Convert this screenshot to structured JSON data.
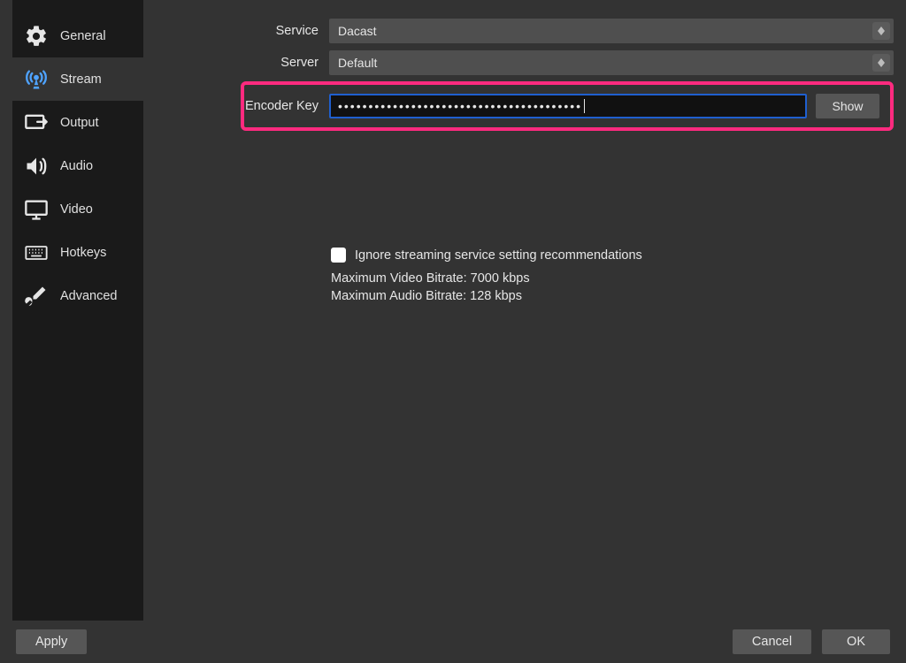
{
  "sidebar": {
    "items": [
      {
        "label": "General"
      },
      {
        "label": "Stream"
      },
      {
        "label": "Output"
      },
      {
        "label": "Audio"
      },
      {
        "label": "Video"
      },
      {
        "label": "Hotkeys"
      },
      {
        "label": "Advanced"
      }
    ],
    "active_index": 1
  },
  "form": {
    "service_label": "Service",
    "service_value": "Dacast",
    "server_label": "Server",
    "server_value": "Default",
    "encoder_label": "Encoder Key",
    "encoder_masked": "••••••••••••••••••••••••••••••••••••••••",
    "show_button": "Show"
  },
  "recommendations": {
    "ignore_label": "Ignore streaming service setting recommendations",
    "ignore_checked": false,
    "max_video": "Maximum Video Bitrate: 7000 kbps",
    "max_audio": "Maximum Audio Bitrate: 128 kbps"
  },
  "footer": {
    "apply": "Apply",
    "cancel": "Cancel",
    "ok": "OK"
  }
}
